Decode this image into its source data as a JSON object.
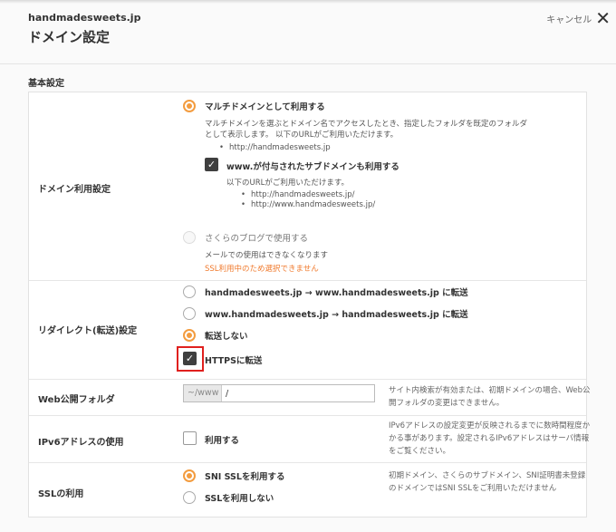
{
  "header": {
    "domain": "handmadesweets.jp",
    "title": "ドメイン設定",
    "cancel_label": "キャンセル"
  },
  "section_title": "基本設定",
  "domain_usage": {
    "label": "ドメイン利用設定",
    "multi": {
      "label": "マルチドメインとして利用する",
      "desc_line1": "マルチドメインを選ぶとドメイン名でアクセスしたとき、指定したフォルダを既定のフォルダ",
      "desc_line2": "として表示します。 以下のURLがご利用いただけます。",
      "url": "http://handmadesweets.jp",
      "www_checkbox_label": "www.が付与されたサブドメインも利用する",
      "www_desc": "以下のURLがご利用いただけます。",
      "www_urls": [
        "http://handmadesweets.jp/",
        "http://www.handmadesweets.jp/"
      ]
    },
    "blog": {
      "label": "さくらのブログで使用する",
      "note": "メールでの使用はできなくなります",
      "warning": "SSL利用中のため選択できません"
    }
  },
  "redirect": {
    "label": "リダイレクト(転送)設定",
    "options": [
      "handmadesweets.jp → www.handmadesweets.jp に転送",
      "www.handmadesweets.jp → handmadesweets.jp に転送",
      "転送しない"
    ],
    "selected_index": 2,
    "https_label": "HTTPSに転送",
    "https_checked": true
  },
  "web_folder": {
    "label": "Web公開フォルダ",
    "prefix": "~/www",
    "value": "/",
    "note": "サイト内検索が有効または、初期ドメインの場合、Web公開フォルダの変更はできません。"
  },
  "ipv6": {
    "label": "IPv6アドレスの使用",
    "checkbox_label": "利用する",
    "checked": false,
    "note": "IPv6アドレスの設定変更が反映されるまでに数時間程度かかる事があります。設定されるIPv6アドレスはサーバ情報をご覧ください。"
  },
  "ssl": {
    "label": "SSLの利用",
    "options": [
      "SNI SSLを利用する",
      "SSLを利用しない"
    ],
    "selected_index": 0,
    "note": "初期ドメイン、さくらのサブドメイン、SNI証明書未登録のドメインではSNI SSLをご利用いただけません"
  },
  "colors": {
    "accent": "#f39c3f",
    "checkbox": "#3f3f3f",
    "warning": "#f07a2d",
    "highlight": "#e0201e"
  }
}
